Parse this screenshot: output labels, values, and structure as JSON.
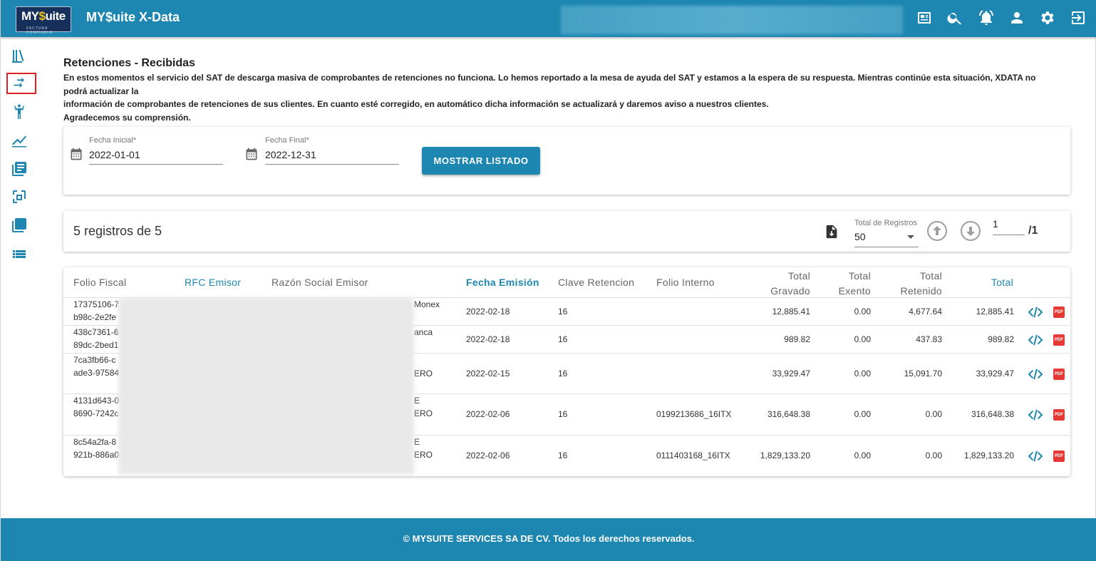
{
  "header": {
    "logo_text_my": "MY",
    "logo_text_dollar": "$",
    "logo_text_uite": "uite",
    "logo_tagline": "FACTURA CONFIABLE",
    "app_title": "MY$uite X-Data"
  },
  "page": {
    "title": "Retenciones - Recibidas",
    "notice_line1": "En estos momentos el servicio del SAT de descarga masiva de comprobantes de retenciones no funciona. Lo hemos reportado a la mesa de ayuda del SAT y estamos a la espera de su respuesta. Mientras continúe esta situación, XDATA no podrá actualizar la",
    "notice_line2": "información de comprobantes de retenciones de sus clientes. En cuanto esté corregido, en automático dicha información se actualizará y daremos aviso a nuestros clientes.",
    "notice_line3": "Agradecemos su comprensión."
  },
  "filters": {
    "start_label": "Fecha Inicial*",
    "start_value": "2022-01-01",
    "end_label": "Fecha Final*",
    "end_value": "2022-12-31",
    "button_label": "MOSTRAR LISTADO"
  },
  "summary": {
    "records_text": "5 registros de 5",
    "total_label": "Total de Registros",
    "total_value": "50",
    "page_value": "1",
    "page_total": "/1"
  },
  "table": {
    "headers": {
      "folio_fiscal": "Folio Fiscal",
      "rfc_emisor": "RFC Emisor",
      "razon_social": "Razón Social Emisor",
      "fecha_emision": "Fecha Emisión",
      "clave_retencion": "Clave Retencion",
      "folio_interno": "Folio Interno",
      "total_gravado_1": "Total",
      "total_gravado_2": "Gravado",
      "total_exento_1": "Total",
      "total_exento_2": "Exento",
      "total_retenido_1": "Total",
      "total_retenido_2": "Retenido",
      "total": "Total"
    },
    "rows": [
      {
        "folio_1": "17375106-7",
        "folio_2": "b98c-2e2fe",
        "razon_1": "Monex",
        "razon_2": "",
        "fecha": "2022-02-18",
        "clave": "16",
        "folio_interno": "",
        "gravado": "12,885.41",
        "exento": "0.00",
        "retenido": "4,677.64",
        "total": "12,885.41"
      },
      {
        "folio_1": "438c7361-6",
        "folio_2": "89dc-2bed1",
        "razon_1": "anca",
        "razon_2": "",
        "fecha": "2022-02-18",
        "clave": "16",
        "folio_interno": "",
        "gravado": "989.82",
        "exento": "0.00",
        "retenido": "437.83",
        "total": "989.82"
      },
      {
        "folio_1": "7ca3fb66-c",
        "folio_2": "ade3-97584",
        "razon_1": "ERO",
        "razon_2": "",
        "fecha": "2022-02-15",
        "clave": "16",
        "folio_interno": "",
        "gravado": "33,929.47",
        "exento": "0.00",
        "retenido": "15,091.70",
        "total": "33,929.47"
      },
      {
        "folio_1": "4131d643-0",
        "folio_2": "8690-7242c",
        "razon_1": "E",
        "razon_2": "ERO",
        "fecha": "2022-02-06",
        "clave": "16",
        "folio_interno": "0199213686_16ITX",
        "gravado": "316,648.38",
        "exento": "0.00",
        "retenido": "0.00",
        "total": "316,648.38"
      },
      {
        "folio_1": "8c54a2fa-8",
        "folio_2": "921b-886a0",
        "razon_1": "E",
        "razon_2": "ERO",
        "fecha": "2022-02-06",
        "clave": "16",
        "folio_interno": "0111403168_16ITX",
        "gravado": "1,829,133.20",
        "exento": "0.00",
        "retenido": "0.00",
        "total": "1,829,133.20"
      }
    ],
    "pdf_label": "PDF"
  },
  "footer": {
    "text": "© MYSUITE SERVICES SA DE CV. Todos los derechos reservados."
  },
  "icons": {
    "top": [
      "news-icon",
      "search-icon",
      "alarm-icon",
      "user-icon",
      "settings-icon",
      "logout-icon"
    ],
    "sidebar": [
      "library-icon",
      "transfer-icon",
      "person-icon",
      "chart-line-icon",
      "documents-icon",
      "file-compare-icon",
      "layers-icon",
      "list-icon"
    ]
  },
  "colors": {
    "primary": "#1d87b1",
    "active_border": "#e02020",
    "pdf": "#e53935"
  }
}
